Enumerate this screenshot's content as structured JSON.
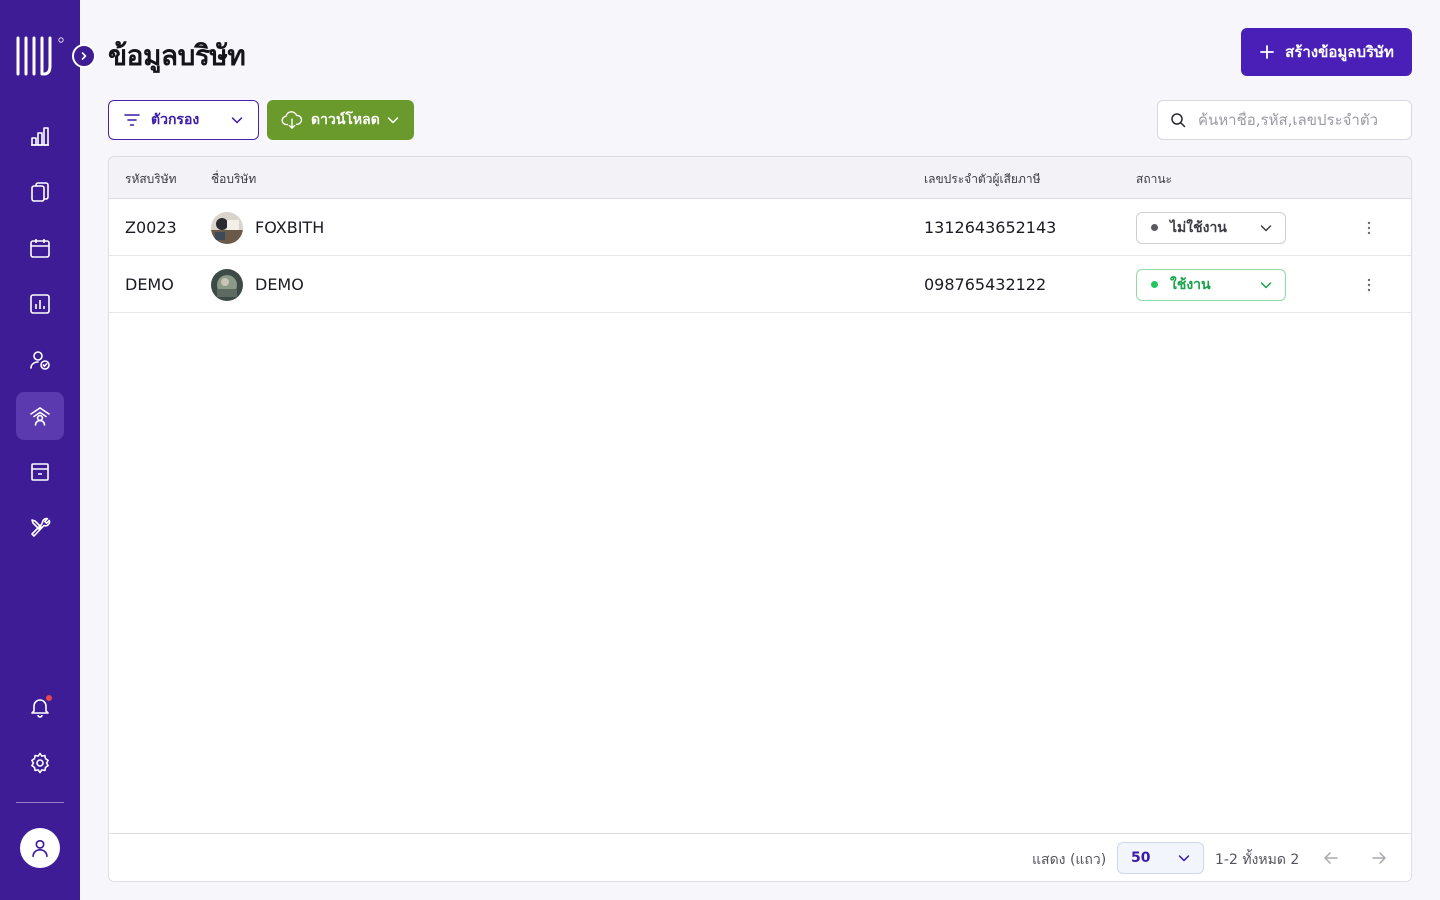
{
  "colors": {
    "sidebar": "#3d1c96",
    "primary": "#4a1fb8",
    "download": "#6a9a2c",
    "active_status": "#16a34a",
    "inactive_status": "#5a5a62"
  },
  "sidebar": {
    "logo_icon": "brand-logo-icon",
    "items": [
      {
        "icon": "chart-bars-icon",
        "active": false
      },
      {
        "icon": "documents-icon",
        "active": false
      },
      {
        "icon": "calendar-icon",
        "active": false
      },
      {
        "icon": "report-chart-icon",
        "active": false
      },
      {
        "icon": "user-check-icon",
        "active": false
      },
      {
        "icon": "company-signal-icon",
        "active": true
      },
      {
        "icon": "archive-box-icon",
        "active": false
      },
      {
        "icon": "tools-icon",
        "active": false
      }
    ],
    "bottom": [
      "bell-icon",
      "gear-icon",
      "user-icon"
    ]
  },
  "header": {
    "title": "ข้อมูลบริษัท",
    "create_label": "สร้างข้อมูลบริษัท"
  },
  "toolbar": {
    "filter_label": "ตัวกรอง",
    "download_label": "ดาวน์โหลด",
    "search_placeholder": "ค้นหาชื่อ,รหัส,เลขประจำตัว",
    "search_value": ""
  },
  "table": {
    "columns": [
      "รหัสบริษัท",
      "ชื่อบริษัท",
      "เลขประจำตัวผู้เสียภาษี",
      "สถานะ"
    ],
    "rows": [
      {
        "code": "Z0023",
        "name": "FOXBITH",
        "tax_id": "1312643652143",
        "status": "ไม่ใช้งาน",
        "active": false
      },
      {
        "code": "DEMO",
        "name": "DEMO",
        "tax_id": "098765432122",
        "status": "ใช้งาน",
        "active": true
      }
    ]
  },
  "footer": {
    "rows_label": "แสดง (แถว)",
    "rows_per_page": "50",
    "range_label": "1-2 ทั้งหมด 2"
  }
}
